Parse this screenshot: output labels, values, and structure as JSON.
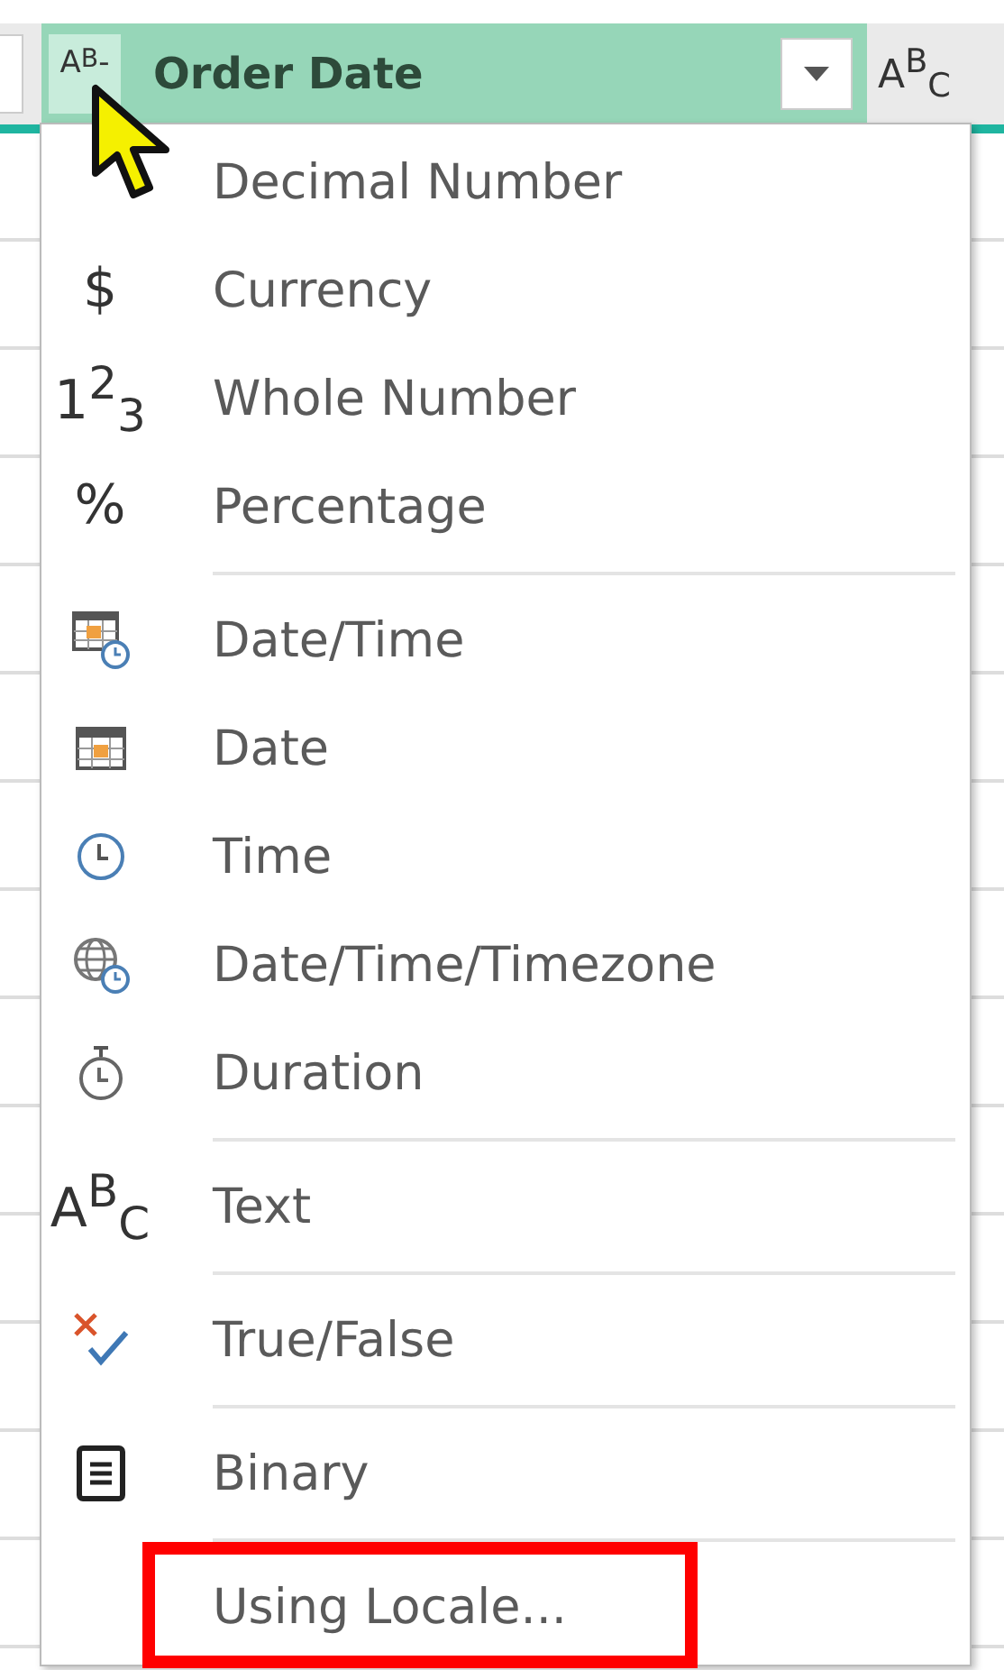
{
  "header": {
    "type_icon": "A$^{B}$-",
    "title": "Order Date",
    "next_type_icon": "A$^{B}$$_{C}$"
  },
  "menu": {
    "groups": [
      {
        "items": [
          {
            "label": "Decimal Number"
          },
          {
            "label": "Currency",
            "icon": {
              "kind": "glyph",
              "text": "$"
            }
          },
          {
            "label": "Whole Number",
            "icon": {
              "kind": "glyph",
              "text": "1$^{2}$$_{3}$"
            }
          },
          {
            "label": "Percentage",
            "icon": {
              "kind": "glyph",
              "text": "%"
            }
          }
        ]
      },
      {
        "items": [
          {
            "label": "Date/Time",
            "icon": {
              "kind": "calendar-clock"
            }
          },
          {
            "label": "Date",
            "icon": {
              "kind": "calendar"
            }
          },
          {
            "label": "Time",
            "icon": {
              "kind": "clock"
            }
          },
          {
            "label": "Date/Time/Timezone",
            "icon": {
              "kind": "globe-clock"
            }
          },
          {
            "label": "Duration",
            "icon": {
              "kind": "stopwatch"
            }
          }
        ]
      },
      {
        "items": [
          {
            "label": "Text",
            "icon": {
              "kind": "glyph",
              "text": "A$^{B}$$_{C}$"
            }
          }
        ]
      },
      {
        "items": [
          {
            "label": "True/False",
            "icon": {
              "kind": "cross-check"
            }
          }
        ]
      },
      {
        "items": [
          {
            "label": "Binary",
            "icon": {
              "kind": "document"
            }
          }
        ]
      },
      {
        "items": [
          {
            "label": "Using Locale...",
            "highlighted": true
          }
        ]
      }
    ]
  }
}
